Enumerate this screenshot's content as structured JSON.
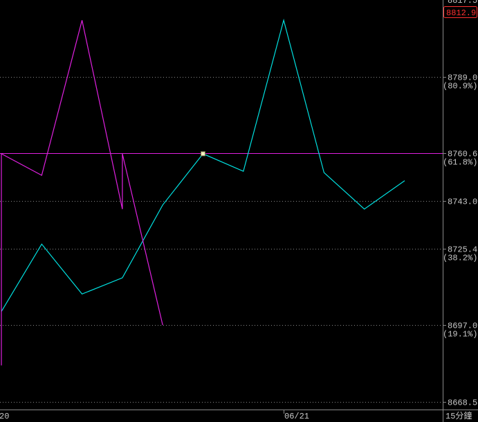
{
  "chart_data": {
    "type": "line",
    "y_ticks": [
      {
        "value": 8789.0,
        "label": "8789.0",
        "pct": "(80.9%)"
      },
      {
        "value": 8760.6,
        "label": "8760.6",
        "pct": "(61.8%)"
      },
      {
        "value": 8743.0,
        "label": "8743.0",
        "pct": ""
      },
      {
        "value": 8725.4,
        "label": "8725.4",
        "pct": "(38.2%)"
      },
      {
        "value": 8697.0,
        "label": "8697.0",
        "pct": "(19.1%)"
      },
      {
        "value": 8668.5,
        "label": "8668.5",
        "pct": ""
      }
    ],
    "top_partial_label": "8817.5",
    "current_price": "8812.9",
    "x_labels": {
      "left": "20",
      "middle": "06/21",
      "right": "15分鐘"
    },
    "series": [
      {
        "color": "#00e0e0",
        "x": [
          0,
          1,
          2,
          3,
          4,
          5,
          6,
          7,
          8,
          9,
          10
        ],
        "y": [
          8702.0,
          8727.0,
          8708.5,
          8714.5,
          8741.5,
          8760.5,
          8754.0,
          8810.0,
          8753.5,
          8740.0,
          8750.5
        ]
      },
      {
        "color": "#e020e0",
        "x": [
          0,
          0,
          1,
          2,
          3,
          3,
          4
        ],
        "y": [
          8682.0,
          8760.5,
          8752.5,
          8810.0,
          8740.0,
          8760.5,
          8697.0
        ]
      }
    ],
    "horizontal_line": {
      "value": 8760.6,
      "color": "#e020e0"
    },
    "marker": {
      "x": 5,
      "y": 8760.5
    },
    "ylim": [
      8668.5,
      8817.5
    ],
    "grid": true
  }
}
